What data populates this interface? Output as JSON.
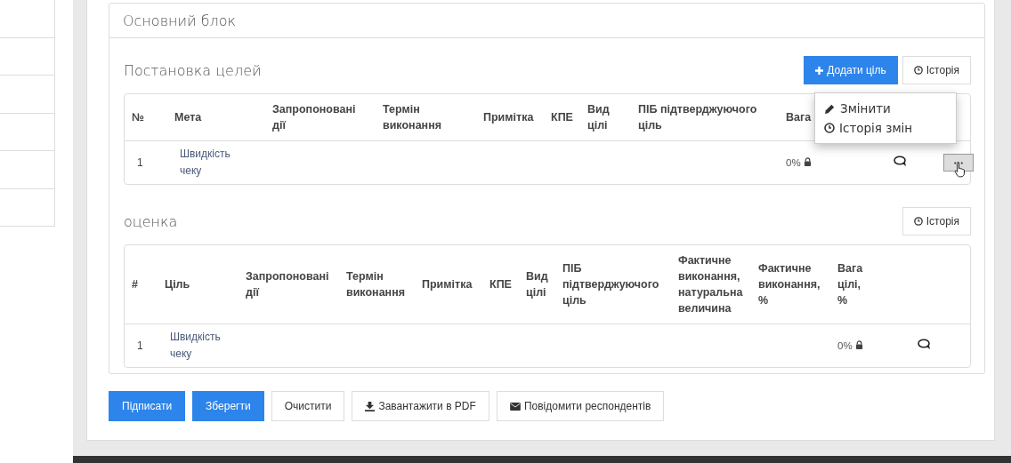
{
  "card": {
    "title": "Основний блок"
  },
  "sections": [
    {
      "title": "Постановка целей",
      "buttons": [
        {
          "label": "Додати ціль",
          "kind": "add"
        },
        {
          "label": "Історія",
          "kind": "history"
        }
      ],
      "columns": [
        "№",
        "Мета",
        "Запропоновані дії",
        "Термін виконання",
        "Примітка",
        "КПЕ",
        "Вид цілі",
        "ПІБ підтверджуючого ціль",
        "Вага"
      ],
      "rows": [
        {
          "number": "1",
          "goal": "Швидкість чеку",
          "weight": "0%",
          "actions": true
        }
      ],
      "menu": {
        "open": true,
        "items": [
          {
            "label": "Змінити",
            "kind": "edit"
          },
          {
            "label": "Історія змін",
            "kind": "history"
          }
        ]
      }
    },
    {
      "title": "оценка",
      "buttons": [
        {
          "label": "Історія",
          "kind": "history"
        }
      ],
      "columns": [
        "#",
        "Ціль",
        "Запропоновані дії",
        "Термін виконання",
        "Примітка",
        "КПЕ",
        "Вид цілі",
        "ПІБ підтверджуючого ціль",
        "Фактичне виконання, натуральна величина",
        "Фактичне виконання, %",
        "Вага цілі, %"
      ],
      "rows": [
        {
          "number": "1",
          "goal": "Швидкість чеку",
          "weight": "0%",
          "actions": false
        }
      ]
    }
  ],
  "footer_buttons": [
    {
      "label": "Підписати",
      "kind": "primary"
    },
    {
      "label": "Зберегти",
      "kind": "primary"
    },
    {
      "label": "Очистити",
      "kind": "plain"
    },
    {
      "label": "Завантажити в PDF",
      "kind": "download"
    },
    {
      "label": "Повідомити респондентів",
      "kind": "mail"
    }
  ]
}
